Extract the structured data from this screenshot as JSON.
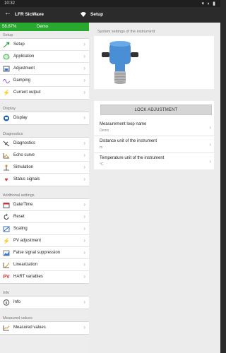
{
  "statusbar": {
    "time": "10:32",
    "system_icons": "▾ ◗ ▮"
  },
  "app": {
    "back_icon": "arrow-left-icon",
    "title": "LFR SicWave",
    "wifi_icon": "wifi-icon",
    "accent": "#29a82f"
  },
  "device_status": {
    "percent": "58.87%",
    "mode": "Demo"
  },
  "nav": {
    "setup": {
      "label": "Setup",
      "items": [
        {
          "label": "Setup",
          "icon": "setup-icon"
        },
        {
          "label": "Application",
          "icon": "application-icon"
        },
        {
          "label": "Adjustment",
          "icon": "adjustment-icon"
        },
        {
          "label": "Damping",
          "icon": "damping-icon"
        },
        {
          "label": "Current output",
          "icon": "lightning-icon"
        }
      ]
    },
    "display": {
      "label": "Display",
      "items": [
        {
          "label": "Display",
          "icon": "display-icon"
        }
      ]
    },
    "diagnostics": {
      "label": "Diagnostics",
      "items": [
        {
          "label": "Diagnostics",
          "icon": "diagnostics-icon"
        },
        {
          "label": "Echo curve",
          "icon": "echo-curve-icon"
        },
        {
          "label": "Simulation",
          "icon": "simulation-icon"
        },
        {
          "label": "Status signals",
          "icon": "heart-icon"
        }
      ]
    },
    "additional": {
      "label": "Additional settings",
      "items": [
        {
          "label": "Date/Time",
          "icon": "calendar-icon"
        },
        {
          "label": "Reset",
          "icon": "reset-icon"
        },
        {
          "label": "Scaling",
          "icon": "scaling-icon"
        },
        {
          "label": "PV adjustment",
          "icon": "lightning-icon"
        },
        {
          "label": "False signal suppression",
          "icon": "false-signal-icon"
        },
        {
          "label": "Linearization",
          "icon": "linearization-icon"
        },
        {
          "label": "HART variables",
          "icon": "pv-icon"
        }
      ]
    },
    "info": {
      "label": "Info",
      "items": [
        {
          "label": "Info",
          "icon": "info-icon"
        }
      ]
    },
    "measured": {
      "label": "Measured values",
      "items": [
        {
          "label": "Measured values",
          "icon": "measured-values-icon"
        }
      ]
    }
  },
  "detail": {
    "title": "Setup",
    "system_caption": "System settings of the instrument",
    "lock_button": "LOCK ADJUSTMENT",
    "params": [
      {
        "label": "Measurement loop name",
        "value": "Demo"
      },
      {
        "label": "Distance unit of the instrument",
        "value": "m"
      },
      {
        "label": "Temperature unit of the instrument",
        "value": "°C"
      }
    ]
  }
}
